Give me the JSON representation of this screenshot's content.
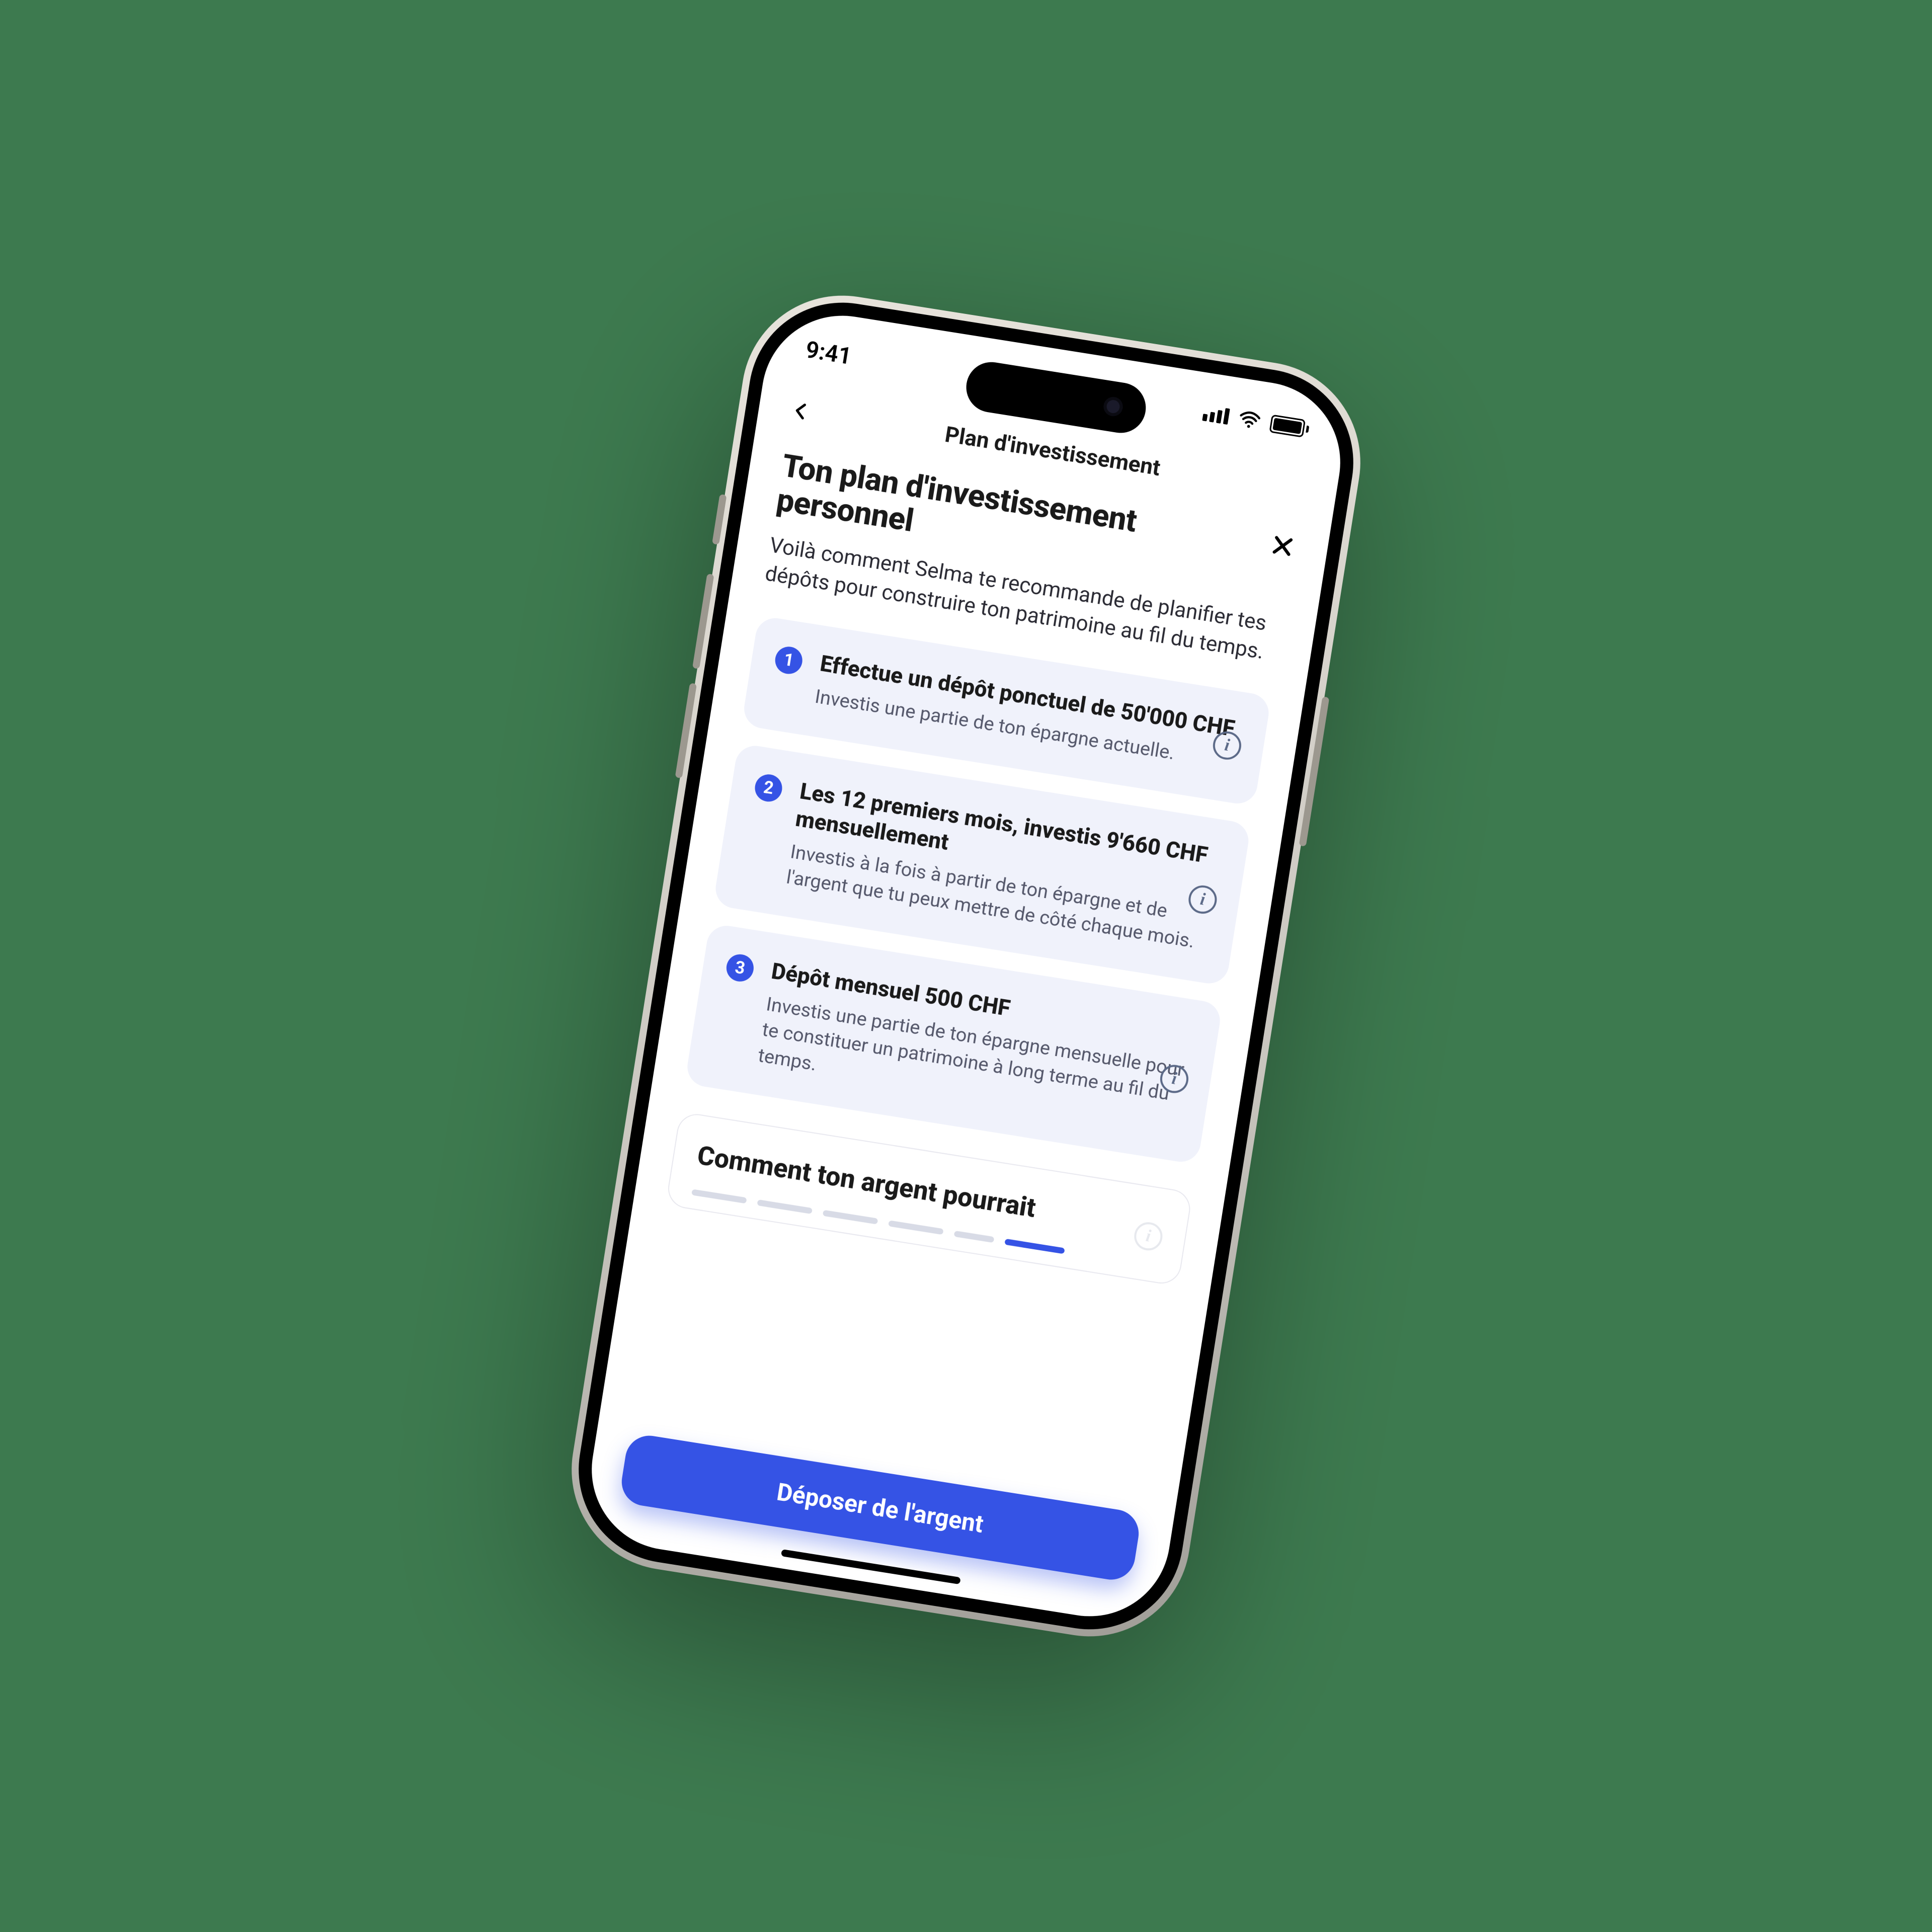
{
  "statusbar": {
    "time": "9:41"
  },
  "nav": {
    "title": "Plan d'investissement"
  },
  "header": {
    "title": "Ton plan d'investissement personnel",
    "subtitle": "Voilà comment Selma  te recommande de planifier tes dépôts pour construire ton patrimoine au fil du temps."
  },
  "steps": [
    {
      "num": "1",
      "title": "Effectue un dépôt ponctuel de 50'000 CHF",
      "desc": "Investis une partie de ton épargne actuelle."
    },
    {
      "num": "2",
      "title": "Les 12 premiers mois, investis 9'660 CHF mensuellement",
      "desc": "Investis à la fois à partir de ton épargne et de l'argent que tu peux mettre de côté chaque mois."
    },
    {
      "num": "3",
      "title": "Dépôt mensuel 500 CHF",
      "desc": "Investis une partie de ton épargne mensuelle pour te constituer un patrimoine à long terme au fil du temps."
    }
  ],
  "lower": {
    "title": "Comment ton argent pourrait"
  },
  "cta": {
    "label": "Déposer de l'argent"
  }
}
